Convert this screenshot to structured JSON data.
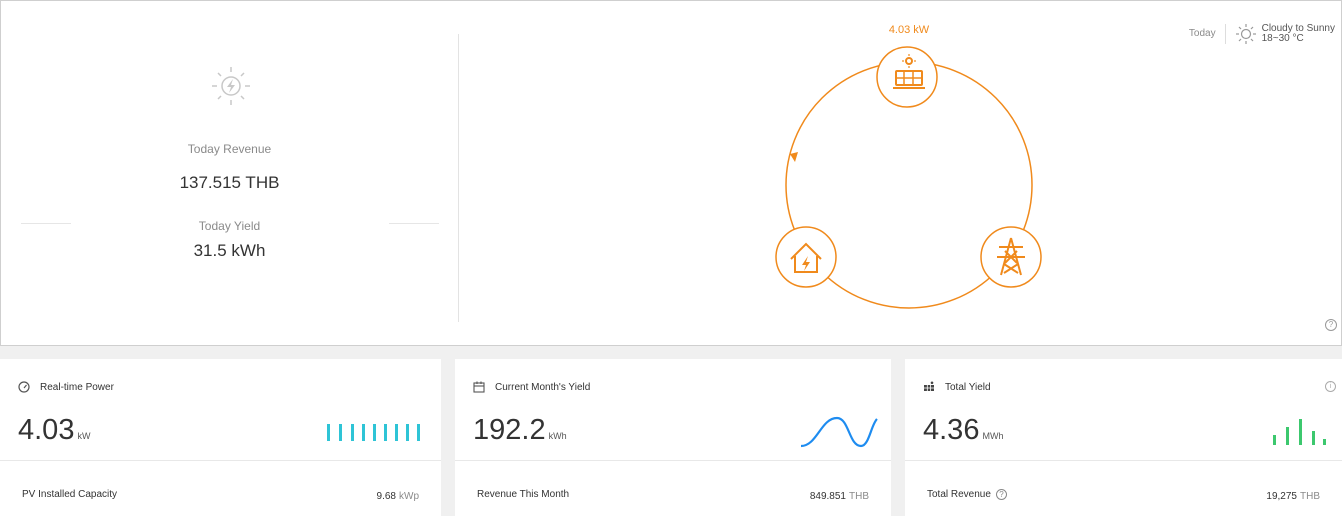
{
  "overview": {
    "revenue_label": "Today Revenue",
    "revenue_value": "137.515 THB",
    "yield_label": "Today Yield",
    "yield_value": "31.5 kWh"
  },
  "flow": {
    "pv_power": "4.03 kW",
    "accent_color": "#f08a1c"
  },
  "weather": {
    "day": "Today",
    "condition": "Cloudy to Sunny",
    "temperature": "18~30 °C",
    "icon": "sun-icon"
  },
  "cards": [
    {
      "title": "Real-time Power",
      "icon": "gauge-icon",
      "value": "4.03",
      "unit": "kW",
      "footer_label": "PV Installed Capacity",
      "footer_value": "9.68",
      "footer_unit": "kWp",
      "spark_color": "#2ec4d6"
    },
    {
      "title": "Current Month's Yield",
      "icon": "calendar-icon",
      "value": "192.2",
      "unit": "kWh",
      "footer_label": "Revenue This Month",
      "footer_value": "849.851",
      "footer_unit": "THB",
      "spark_color": "#1e8cf0"
    },
    {
      "title": "Total Yield",
      "icon": "solar-panel-icon",
      "value": "4.36",
      "unit": "MWh",
      "footer_label": "Total Revenue",
      "footer_value": "19,275",
      "footer_unit": "THB",
      "spark_color": "#3cc86e"
    }
  ]
}
